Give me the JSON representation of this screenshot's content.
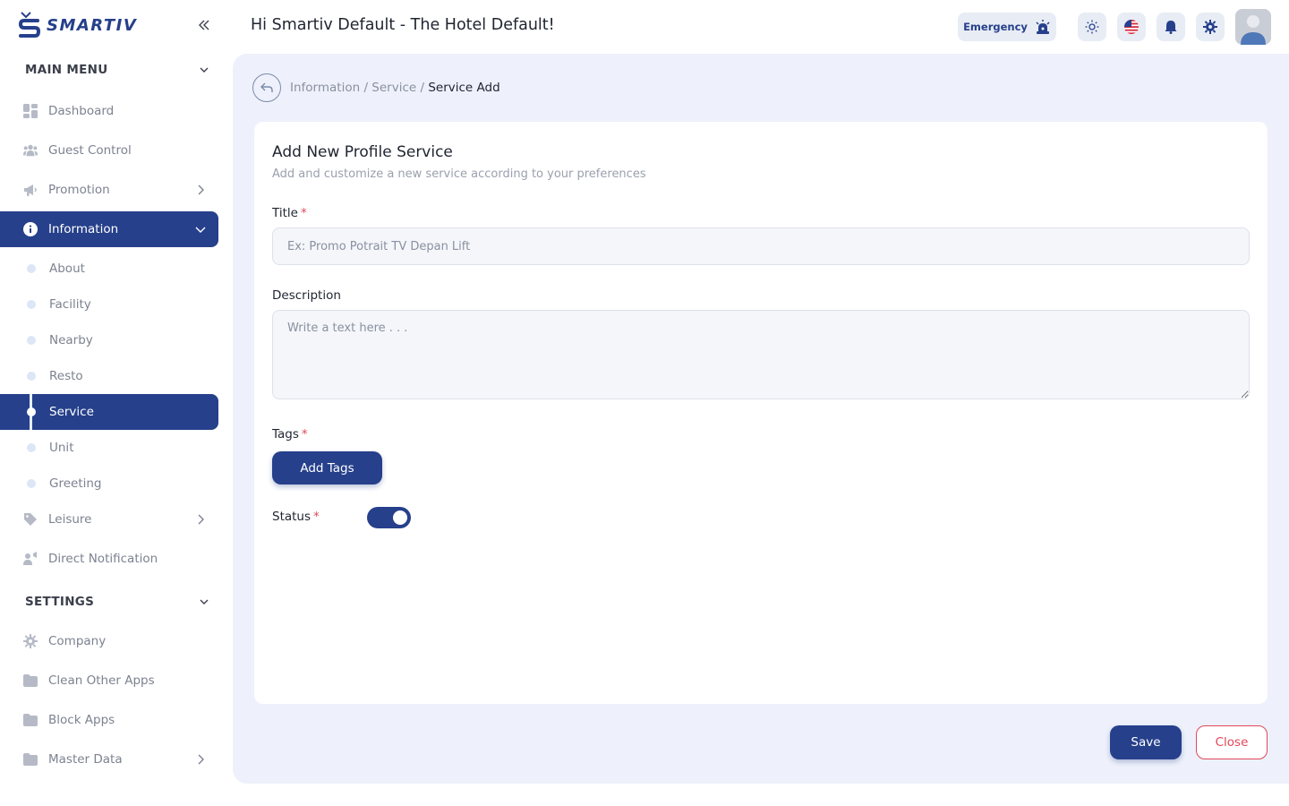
{
  "brand": {
    "name": "SMARTIV"
  },
  "sidebar": {
    "main_menu_label": "MAIN MENU",
    "items": [
      {
        "label": "Dashboard",
        "icon": "dashboard-icon"
      },
      {
        "label": "Guest Control",
        "icon": "users-icon"
      },
      {
        "label": "Promotion",
        "icon": "megaphone-icon"
      },
      {
        "label": "Information",
        "icon": "info-icon"
      }
    ],
    "information_sub": [
      "About",
      "Facility",
      "Nearby",
      "Resto",
      "Service",
      "Unit",
      "Greeting"
    ],
    "more_items": [
      {
        "label": "Leisure",
        "icon": "tag-icon"
      },
      {
        "label": "Direct Notification",
        "icon": "notification-icon"
      }
    ],
    "settings_label": "SETTINGS",
    "settings_items": [
      {
        "label": "Company",
        "icon": "gear-icon"
      },
      {
        "label": "Clean Other Apps",
        "icon": "folder-icon"
      },
      {
        "label": "Block Apps",
        "icon": "folder-icon"
      },
      {
        "label": "Master Data",
        "icon": "folder-icon"
      }
    ]
  },
  "header": {
    "greeting": "Hi Smartiv Default - The Hotel Default!",
    "emergency_label": "Emergency"
  },
  "breadcrumb": {
    "items": [
      "Information",
      "Service"
    ],
    "current": "Service Add"
  },
  "form": {
    "title": "Add New Profile Service",
    "subtitle": "Add and customize a new service according to your preferences",
    "title_label": "Title",
    "title_placeholder": "Ex: Promo Potrait TV Depan Lift",
    "description_label": "Description",
    "description_placeholder": "Write a text here . . .",
    "tags_label": "Tags",
    "add_tags_label": "Add Tags",
    "status_label": "Status",
    "status_on": true,
    "required_mark": "*"
  },
  "actions": {
    "save": "Save",
    "close": "Close"
  },
  "colors": {
    "primary": "#26408b",
    "danger": "#e0485a",
    "background": "#eef1fb"
  }
}
